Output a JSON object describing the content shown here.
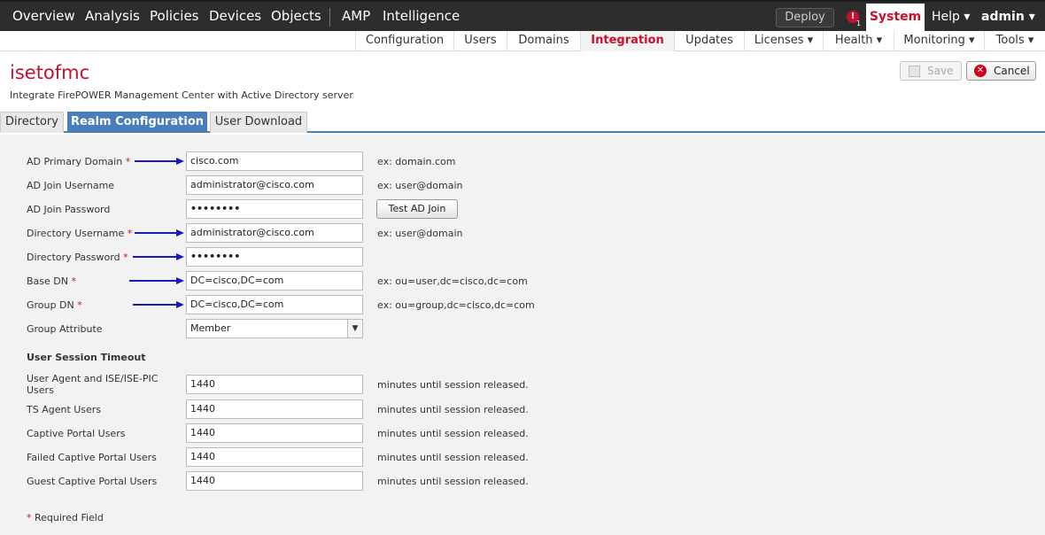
{
  "top_nav": {
    "items": [
      "Overview",
      "Analysis",
      "Policies",
      "Devices",
      "Objects",
      "AMP",
      "Intelligence"
    ],
    "deploy": "Deploy",
    "alert_count": "1",
    "system": "System",
    "help": "Help ▾",
    "user": "admin ▾"
  },
  "sub_nav": {
    "items": [
      "Configuration",
      "Users",
      "Domains",
      "Integration",
      "Updates",
      "Licenses ▾",
      "Health ▾",
      "Monitoring ▾",
      "Tools ▾"
    ],
    "active": "Integration"
  },
  "page": {
    "title": "isetofmc",
    "subtitle": "Integrate FirePOWER Management Center with Active Directory server",
    "save": "Save",
    "cancel": "Cancel"
  },
  "tabs": [
    "Directory",
    "Realm Configuration",
    "User Download"
  ],
  "active_tab": "Realm Configuration",
  "form": {
    "fields": [
      {
        "label": "AD Primary Domain",
        "required": "*",
        "value": "cisco.com",
        "hint": "ex: domain.com"
      },
      {
        "label": "AD Join Username",
        "required": "",
        "value": "administrator@cisco.com",
        "hint": "ex: user@domain"
      },
      {
        "label": "AD Join Password",
        "required": "",
        "value": "••••••••",
        "hint": ""
      },
      {
        "label": "Directory Username",
        "required": "*",
        "value": "administrator@cisco.com",
        "hint": "ex: user@domain"
      },
      {
        "label": "Directory Password",
        "required": "*",
        "value": "••••••••",
        "hint": ""
      },
      {
        "label": "Base DN",
        "required": "*",
        "value": "DC=cisco,DC=com",
        "hint": "ex: ou=user,dc=cisco,dc=com"
      },
      {
        "label": "Group DN",
        "required": "*",
        "value": "DC=cisco,DC=com",
        "hint": "ex: ou=group,dc=cisco,dc=com"
      },
      {
        "label": "Group Attribute",
        "required": "",
        "value": "Member",
        "hint": ""
      }
    ],
    "test_button": "Test AD Join",
    "session_title": "User Session Timeout",
    "session_fields": [
      {
        "label": "User Agent and ISE/ISE-PIC Users",
        "value": "1440",
        "hint": "minutes until session released."
      },
      {
        "label": "TS Agent Users",
        "value": "1440",
        "hint": "minutes until session released."
      },
      {
        "label": "Captive Portal Users",
        "value": "1440",
        "hint": "minutes until session released."
      },
      {
        "label": "Failed Captive Portal Users",
        "value": "1440",
        "hint": "minutes until session released."
      },
      {
        "label": "Guest Captive Portal Users",
        "value": "1440",
        "hint": "minutes until session released."
      }
    ],
    "required_note_star": "*",
    "required_note": "Required Field"
  },
  "colors": {
    "brand_red": "#c8102e",
    "tab_blue": "#4a7eba",
    "arrow_blue": "#1a1ab8"
  }
}
